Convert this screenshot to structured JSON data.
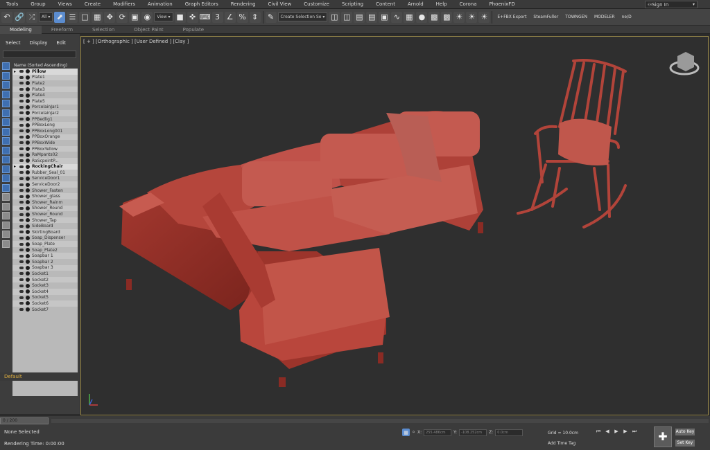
{
  "menu": {
    "items": [
      "Tools",
      "Group",
      "Views",
      "Create",
      "Modifiers",
      "Animation",
      "Graph Editors",
      "Rendering",
      "Civil View",
      "Customize",
      "Scripting",
      "Content",
      "Arnold",
      "Help",
      "Corona",
      "PhoenixFD"
    ],
    "signin": "Sign In"
  },
  "toolbar": {
    "filter_dropdown": "All",
    "view_dropdown": "View",
    "selection_set": "Create Selection Se",
    "plugin1": "E+FBX Export",
    "plugin2": "SteamFuller",
    "plugin3": "TOWNGEN",
    "plugin4": "MODELER",
    "plugin5": "ne/D"
  },
  "ribbon": {
    "tabs": [
      "Modeling",
      "Freeform",
      "Selection",
      "Object Paint",
      "Populate"
    ]
  },
  "command_panel": {
    "tabs": [
      "Select",
      "Display",
      "Edit"
    ],
    "scene_header": "Name (Sorted Ascending)",
    "objects": [
      {
        "name": "Pillow",
        "group": true
      },
      {
        "name": "Plate1"
      },
      {
        "name": "Plate2"
      },
      {
        "name": "Plate3"
      },
      {
        "name": "Plate4"
      },
      {
        "name": "Plate5"
      },
      {
        "name": "PorcelainJar1"
      },
      {
        "name": "PorcelainJar2"
      },
      {
        "name": "PPBedlig1"
      },
      {
        "name": "PPBoxLong"
      },
      {
        "name": "PPBoxLong001"
      },
      {
        "name": "PPBoxOrange"
      },
      {
        "name": "PPBoxWide"
      },
      {
        "name": "PPBoxYellow"
      },
      {
        "name": "RaMpants02"
      },
      {
        "name": "RaScpointP..."
      },
      {
        "name": "RockingChair",
        "group": true
      },
      {
        "name": "Rubber_Seal_01"
      },
      {
        "name": "ServiceDoor1"
      },
      {
        "name": "ServiceDoor2"
      },
      {
        "name": "Shower_Fasten"
      },
      {
        "name": "Shower_glass"
      },
      {
        "name": "Shower_Rainm"
      },
      {
        "name": "Shower_Round"
      },
      {
        "name": "Shower_Round"
      },
      {
        "name": "Shower_Tap"
      },
      {
        "name": "SideBoard"
      },
      {
        "name": "SkirtingBoard"
      },
      {
        "name": "Soap_Dispenser"
      },
      {
        "name": "Soap_Plate"
      },
      {
        "name": "Soap_Plate2"
      },
      {
        "name": "Soapbar 1"
      },
      {
        "name": "Soapbar 2"
      },
      {
        "name": "Soapbar 3"
      },
      {
        "name": "Socket1"
      },
      {
        "name": "Socket2"
      },
      {
        "name": "Socket3"
      },
      {
        "name": "Socket4"
      },
      {
        "name": "Socket5"
      },
      {
        "name": "Socket6"
      },
      {
        "name": "Socket7"
      }
    ],
    "layer": "Default"
  },
  "viewport": {
    "label": "[ + ] [Orthographic ] [User Defined ] [Clay ]"
  },
  "statusbar": {
    "time_slider": "0 / 200",
    "selection": "None Selected",
    "render_time": "Rendering Time: 0:00:00",
    "x_label": "X:",
    "x_value": "255.486cm",
    "y_label": "Y:",
    "y_value": "-108.252cm",
    "z_label": "Z:",
    "z_value": "0.0cm",
    "grid": "Grid = 10.0cm",
    "add_time_tag": "Add Time Tag",
    "auto_key": "Auto Key",
    "set_key": "Set Key"
  }
}
